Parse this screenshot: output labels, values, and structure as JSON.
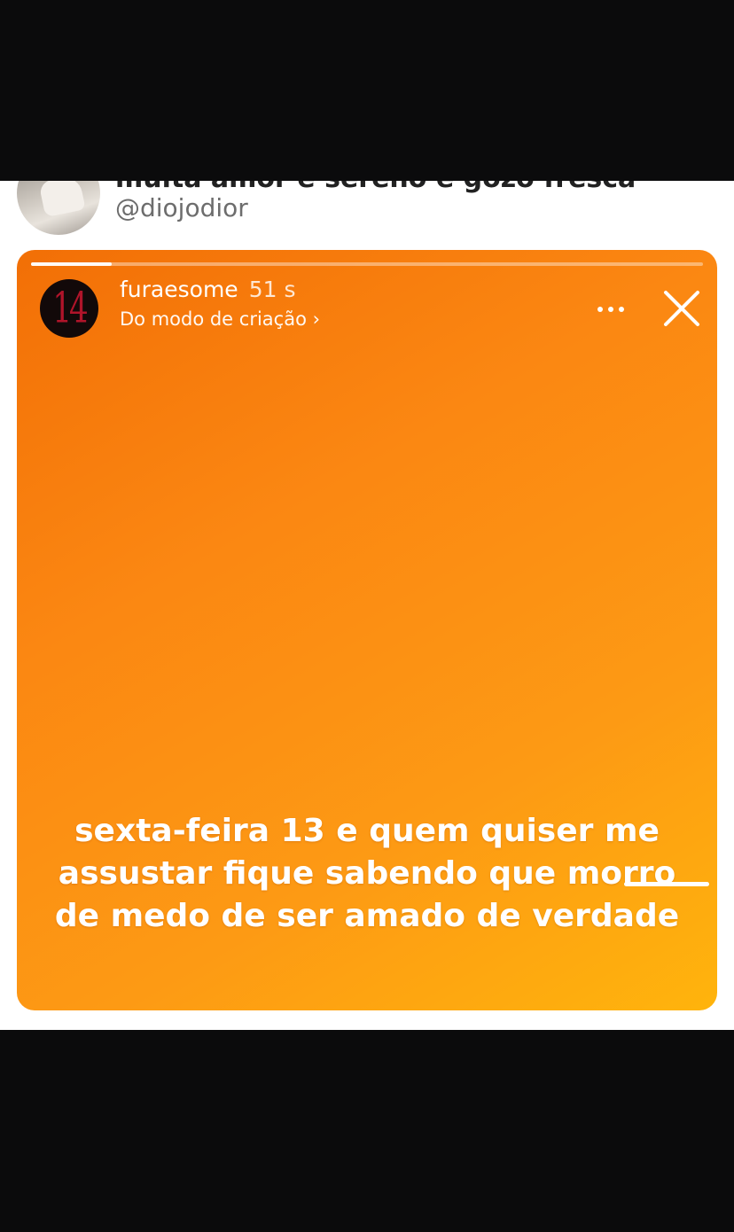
{
  "tweet": {
    "display_name": "muita amor e sereno e gozo fresca",
    "handle": "@diojodior"
  },
  "story": {
    "progress": 0.12,
    "avatar_text": "14",
    "username": "furaesome",
    "time": "51 s",
    "subtitle": "Do modo de criação ›",
    "caption_lines": [
      "sexta-feira 13 e quem quiser me",
      "assustar fique sabendo que morro",
      "de medo de ser amado de verdade"
    ],
    "colors": {
      "gradient_start": "#f26f06",
      "gradient_end": "#ffb40c"
    }
  },
  "icons": {
    "more": "more-horizontal-icon",
    "close": "close-icon"
  }
}
